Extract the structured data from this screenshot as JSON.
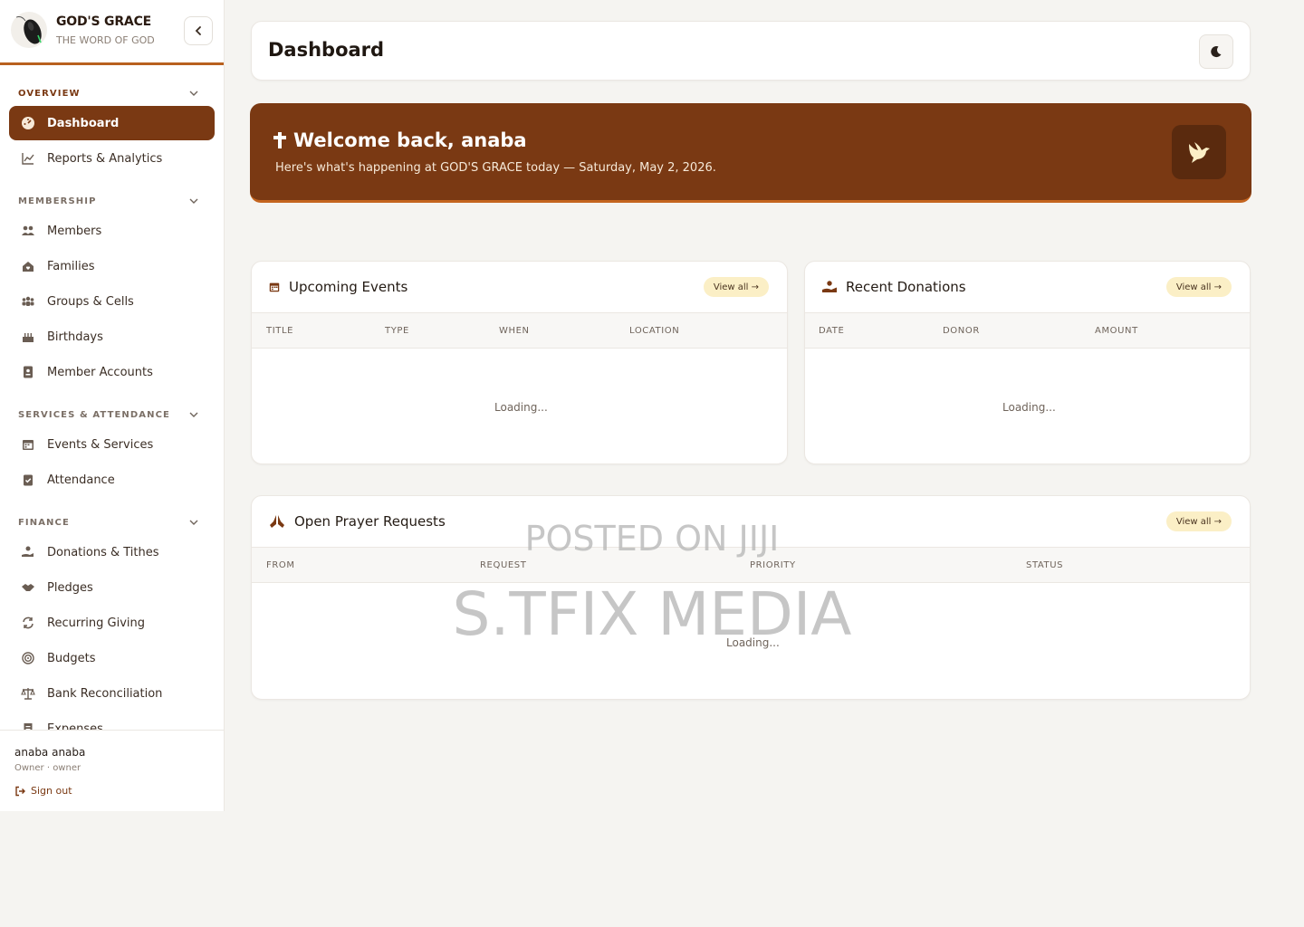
{
  "brand": {
    "name": "GOD'S GRACE",
    "tagline": "THE WORD OF GOD"
  },
  "sidebar": {
    "sections": [
      {
        "title": "OVERVIEW",
        "items": [
          "Dashboard",
          "Reports & Analytics"
        ]
      },
      {
        "title": "MEMBERSHIP",
        "items": [
          "Members",
          "Families",
          "Groups & Cells",
          "Birthdays",
          "Member Accounts"
        ]
      },
      {
        "title": "SERVICES & ATTENDANCE",
        "items": [
          "Events & Services",
          "Attendance"
        ]
      },
      {
        "title": "FINANCE",
        "items": [
          "Donations & Tithes",
          "Pledges",
          "Recurring Giving",
          "Budgets",
          "Bank Reconciliation",
          "Expenses"
        ]
      }
    ],
    "active_item": "Dashboard"
  },
  "user": {
    "name": "anaba anaba",
    "role": "Owner · owner",
    "sign_out": "Sign out"
  },
  "header": {
    "title": "Dashboard"
  },
  "welcome": {
    "title": "Welcome back, anaba",
    "subtitle": "Here's what's happening at GOD'S GRACE today — Saturday, May 2, 2026."
  },
  "events_card": {
    "title": "Upcoming Events",
    "view_all": "View all →",
    "columns": [
      "TITLE",
      "TYPE",
      "WHEN",
      "LOCATION"
    ],
    "status": "Loading..."
  },
  "donations_card": {
    "title": "Recent Donations",
    "view_all": "View all →",
    "columns": [
      "DATE",
      "DONOR",
      "AMOUNT"
    ],
    "status": "Loading..."
  },
  "prayer_card": {
    "title": "Open Prayer Requests",
    "view_all": "View all →",
    "columns": [
      "FROM",
      "REQUEST",
      "PRIORITY",
      "STATUS"
    ],
    "status": "Loading..."
  },
  "watermark": {
    "line1": "POSTED ON JIJI",
    "line2": "S.TFIX MEDIA"
  },
  "colors": {
    "accent": "#7a3913",
    "accent_light": "#c4641f",
    "pill": "#fbefc6",
    "background": "#f5f4f1"
  },
  "icons": {
    "Dashboard": "gauge-icon",
    "Reports & Analytics": "chart-line-icon",
    "Members": "users-icon",
    "Families": "home-heart-icon",
    "Groups & Cells": "people-group-icon",
    "Birthdays": "cake-icon",
    "Member Accounts": "id-badge-icon",
    "Events & Services": "calendar-icon",
    "Attendance": "clipboard-check-icon",
    "Donations & Tithes": "hand-coin-icon",
    "Pledges": "handshake-icon",
    "Recurring Giving": "repeat-icon",
    "Budgets": "target-icon",
    "Bank Reconciliation": "scale-icon",
    "Expenses": "receipt-icon"
  }
}
